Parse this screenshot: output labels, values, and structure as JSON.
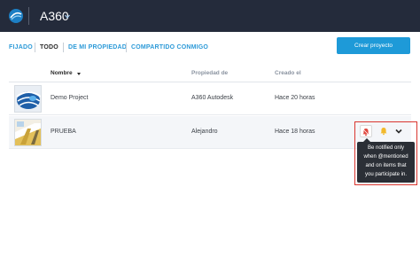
{
  "header": {
    "app_title": "A360",
    "logo_icon": "a360-logo-icon",
    "chevron_icon": "chevron-down-icon"
  },
  "tabs": [
    {
      "label": "FIJADO",
      "active": false
    },
    {
      "label": "TODO",
      "active": true
    },
    {
      "label": "DE MI PROPIEDAD",
      "active": false
    },
    {
      "label": "COMPARTIDO CONMIGO",
      "active": false
    }
  ],
  "actions": {
    "create_project": "Crear proyecto"
  },
  "table": {
    "columns": {
      "name": "Nombre",
      "owner": "Propiedad de",
      "created": "Creado el"
    },
    "sort_icon": "sort-down-icon",
    "rows": [
      {
        "name": "Demo Project",
        "owner": "A360 Autodesk",
        "created": "Hace 20 horas",
        "thumbnail": "project-thumbnail-blue"
      },
      {
        "name": "PRUEBA",
        "owner": "Alejandro",
        "created": "Hace 18 horas",
        "thumbnail": "project-thumbnail-yellow"
      }
    ]
  },
  "notifications": {
    "bell_icon": "bell-mentions-icon",
    "bell_icon_alt": "bell-all-icon",
    "more_icon": "chevron-down-icon",
    "tooltip": [
      "Be notified only",
      "when @mentioned",
      "and on items that",
      "you participate in."
    ]
  },
  "colors": {
    "topbar": "#242b3b",
    "accent": "#1e9ad8",
    "highlight_border": "#d9362f",
    "tooltip_bg": "#2b2f36"
  }
}
